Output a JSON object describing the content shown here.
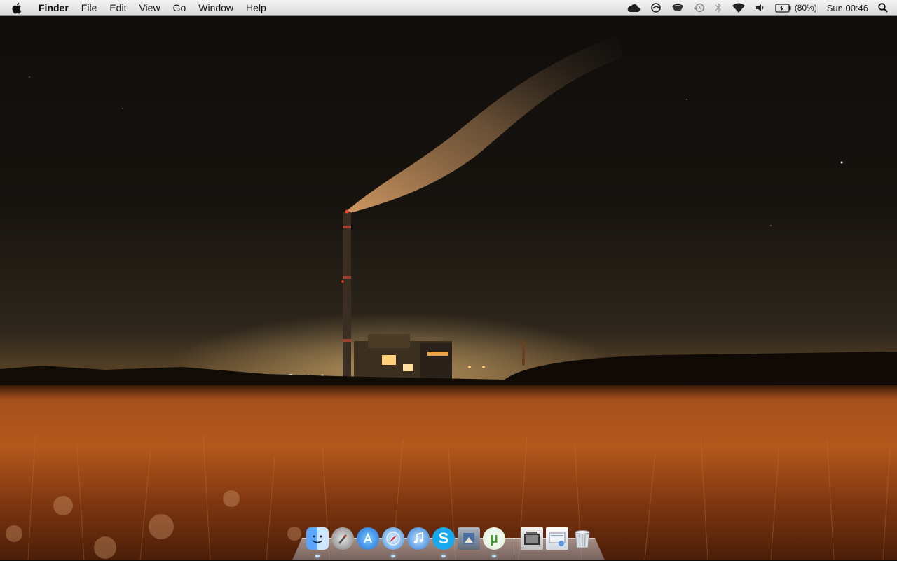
{
  "menubar": {
    "apple_icon": "apple-logo-icon",
    "app_name": "Finder",
    "menus": [
      "File",
      "Edit",
      "View",
      "Go",
      "Window",
      "Help"
    ],
    "status_icons": [
      "icloud-icon",
      "sync-icon",
      "coffee-cup-icon",
      "time-machine-icon",
      "bluetooth-icon",
      "wifi-icon",
      "volume-icon",
      "battery-icon"
    ],
    "battery_percent": "(80%)",
    "clock": "Sun 00:46",
    "spotlight_icon": "spotlight-search-icon"
  },
  "desktop": {
    "wallpaper": "night-power-plant-field"
  },
  "dock": {
    "items": [
      {
        "name": "Finder",
        "icon": "finder-icon",
        "running": true
      },
      {
        "name": "Launchpad",
        "icon": "launchpad-rocket-icon",
        "running": false
      },
      {
        "name": "App Store",
        "icon": "app-store-icon",
        "running": false
      },
      {
        "name": "Safari",
        "icon": "safari-compass-icon",
        "running": true
      },
      {
        "name": "iTunes",
        "icon": "itunes-note-icon",
        "running": false
      },
      {
        "name": "Skype",
        "icon": "skype-icon",
        "running": true
      },
      {
        "name": "Preview",
        "icon": "preview-icon",
        "running": false
      },
      {
        "name": "uTorrent",
        "icon": "utorrent-icon",
        "running": true
      },
      {
        "name": "Documents",
        "icon": "documents-stack-icon",
        "running": false
      },
      {
        "name": "Downloads",
        "icon": "downloads-stack-icon",
        "running": false
      },
      {
        "name": "Trash",
        "icon": "trash-icon",
        "running": false
      }
    ]
  }
}
